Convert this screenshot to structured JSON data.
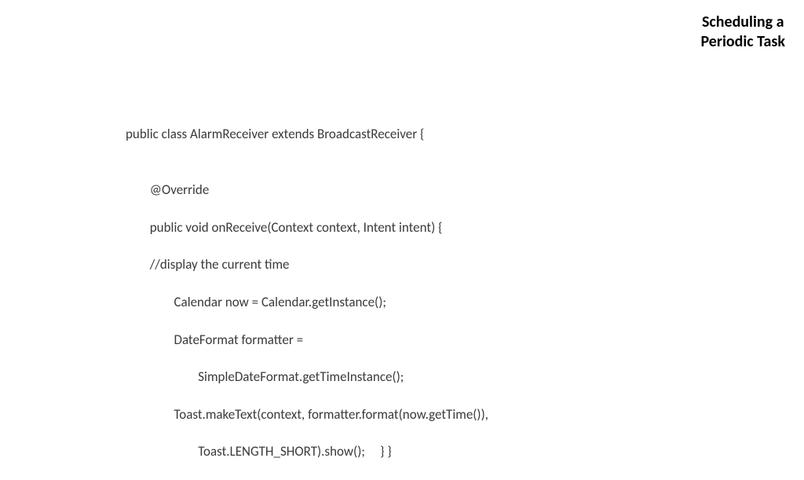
{
  "title": {
    "line1": "Scheduling a",
    "line2": "Periodic Task"
  },
  "code": {
    "line1": "public class AlarmReceiver extends BroadcastReceiver {",
    "line2": "",
    "line3": "\t@Override",
    "line4": "\tpublic void onReceive(Context context, Intent intent) {",
    "line5": "\t//display the current time",
    "line6": "\t\tCalendar now = Calendar.getInstance();",
    "line7": "\t\tDateFormat formatter =",
    "line8": "\t\t\tSimpleDateFormat.getTimeInstance();",
    "line9": "\t\tToast.makeText(context, formatter.format(now.getTime()),",
    "line10": "\t\t\tToast.LENGTH_SHORT).show();     } }"
  }
}
